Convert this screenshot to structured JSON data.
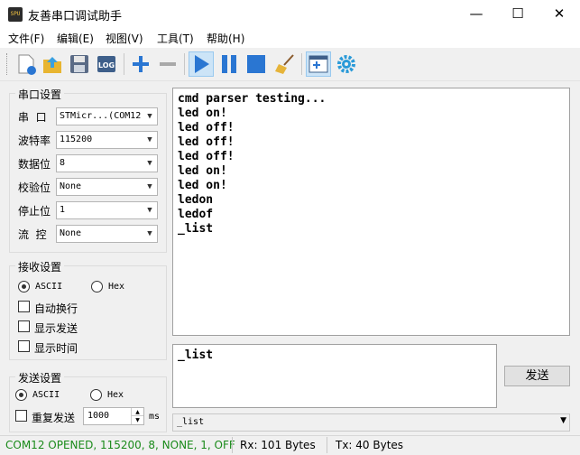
{
  "app": {
    "title": "友善串口调试助手",
    "icon_text": "SPU"
  },
  "window_controls": {
    "minimize": "—",
    "maximize": "☐",
    "close": "✕"
  },
  "menu": [
    "文件(F)",
    "编辑(E)",
    "视图(V)",
    "工具(T)",
    "帮助(H)"
  ],
  "toolbar": {
    "icons": [
      "new-file-icon",
      "open-folder-icon",
      "save-icon",
      "log-icon",
      "plus-icon",
      "minus-icon",
      "play-icon",
      "pause-icon",
      "stop-icon",
      "broom-icon",
      "window-add-icon",
      "gear-icon"
    ],
    "log_label": "LOG"
  },
  "serial": {
    "group_label": "串口设置",
    "port": {
      "label": "串  口",
      "value": "STMicr...(COM12"
    },
    "baud": {
      "label": "波特率",
      "value": "115200"
    },
    "data_bits": {
      "label": "数据位",
      "value": "8"
    },
    "parity": {
      "label": "校验位",
      "value": "None"
    },
    "stop_bits": {
      "label": "停止位",
      "value": "1"
    },
    "flow": {
      "label": "流  控",
      "value": "None"
    }
  },
  "receive": {
    "group_label": "接收设置",
    "ascii": "ASCII",
    "hex": "Hex",
    "mode": "ASCII",
    "auto_wrap": "自动换行",
    "show_send": "显示发送",
    "show_time": "显示时间"
  },
  "send": {
    "group_label": "发送设置",
    "ascii": "ASCII",
    "hex": "Hex",
    "mode": "ASCII",
    "repeat": "重复发送",
    "interval": "1000",
    "unit": "ms"
  },
  "rx_lines": [
    "cmd parser testing...",
    "led on!",
    "led off!",
    "led off!",
    "led off!",
    "led on!",
    "led on!",
    "ledon",
    "ledof",
    "_list"
  ],
  "tx_text": "_list",
  "send_button": "发送",
  "history_value": "_list",
  "status": {
    "connection": "COM12 OPENED, 115200, 8, NONE, 1, OFF",
    "rx": "Rx: 101 Bytes",
    "tx": "Tx: 40 Bytes",
    "connection_color": "#1a8a1a"
  }
}
